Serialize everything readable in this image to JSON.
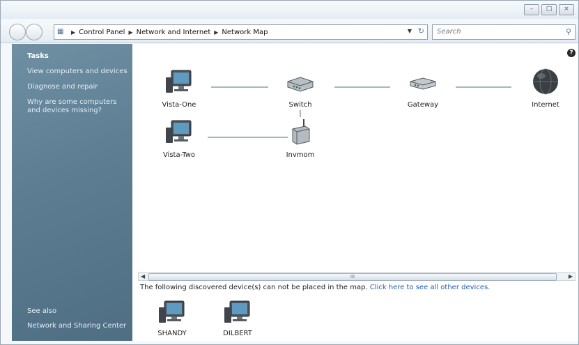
{
  "address": {
    "crumbs": [
      "Control Panel",
      "Network and Internet",
      "Network Map"
    ]
  },
  "search": {
    "placeholder": "Search"
  },
  "sidebar": {
    "tasks_heading": "Tasks",
    "tasks": [
      "View computers and devices",
      "Diagnose and repair",
      "Why are some computers and devices missing?"
    ],
    "see_also_heading": "See also",
    "see_also": [
      "Network and Sharing Center"
    ]
  },
  "map": {
    "devices": [
      "Vista-One",
      "Switch",
      "Gateway",
      "Internet",
      "Vista-Two",
      "Invmom"
    ]
  },
  "notice": {
    "text": "The following discovered device(s) can not be placed in the map. ",
    "link": "Click here to see all other devices."
  },
  "unplaced_devices": [
    "SHANDY",
    "DILBERT"
  ],
  "scrollbar": {
    "grip": "III"
  },
  "colors": {
    "sidebar": "#5c7d92",
    "link": "#1f5fa8",
    "connector": "#a8b6c2"
  }
}
